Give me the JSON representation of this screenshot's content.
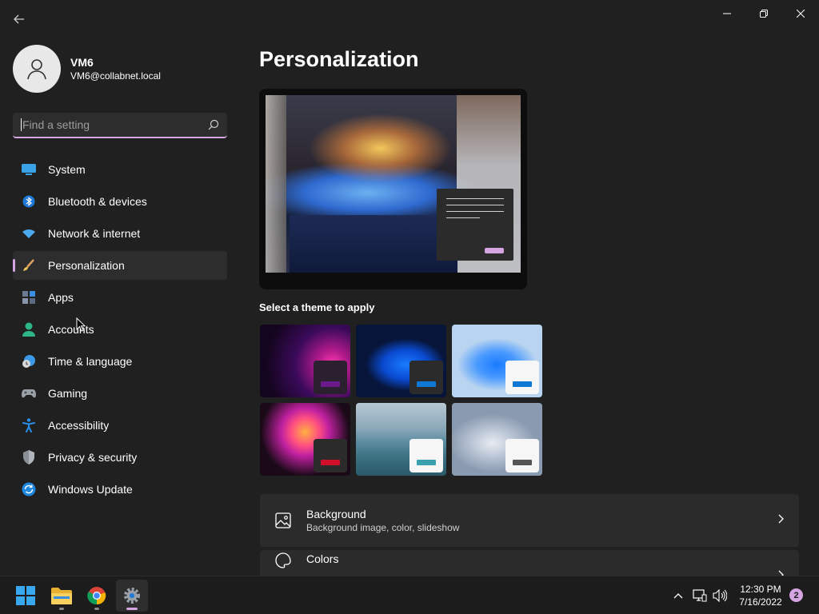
{
  "window": {
    "back_icon": "back-arrow-icon",
    "controls": [
      "minimize-icon",
      "restore-icon",
      "close-icon"
    ]
  },
  "profile": {
    "name": "VM6",
    "email": "VM6@collabnet.local"
  },
  "search": {
    "placeholder": "Find a setting",
    "icon": "search-icon"
  },
  "nav": {
    "items": [
      {
        "label": "System",
        "icon": "system-icon"
      },
      {
        "label": "Bluetooth & devices",
        "icon": "bluetooth-icon"
      },
      {
        "label": "Network & internet",
        "icon": "wifi-icon"
      },
      {
        "label": "Personalization",
        "icon": "brush-icon",
        "active": true
      },
      {
        "label": "Apps",
        "icon": "apps-icon"
      },
      {
        "label": "Accounts",
        "icon": "accounts-icon"
      },
      {
        "label": "Time & language",
        "icon": "clock-globe-icon"
      },
      {
        "label": "Gaming",
        "icon": "gamepad-icon"
      },
      {
        "label": "Accessibility",
        "icon": "accessibility-icon"
      },
      {
        "label": "Privacy & security",
        "icon": "shield-icon"
      },
      {
        "label": "Windows Update",
        "icon": "update-icon"
      }
    ]
  },
  "main": {
    "title": "Personalization",
    "themes_label": "Select a theme to apply",
    "themes": [
      {
        "name": "glow",
        "accent": "#6a1a8a"
      },
      {
        "name": "windows-dark",
        "accent": "#0f78d4"
      },
      {
        "name": "windows-light",
        "accent": "#0f78d4"
      },
      {
        "name": "captured-motion",
        "accent": "#d0102a"
      },
      {
        "name": "flow",
        "accent": "#3aa0b0"
      },
      {
        "name": "sunrise",
        "accent": "#555555"
      }
    ],
    "cards": [
      {
        "title": "Background",
        "subtitle": "Background image, color, slideshow",
        "icon": "image-icon"
      },
      {
        "title": "Colors",
        "subtitle": "",
        "icon": "palette-icon"
      }
    ]
  },
  "taskbar": {
    "apps": [
      "windows-start-icon",
      "file-explorer-icon",
      "chrome-icon",
      "settings-icon"
    ],
    "active_app": "settings-icon",
    "tray": [
      "chevron-up-icon",
      "network-icon",
      "volume-icon"
    ],
    "time": "12:30 PM",
    "date": "7/16/2022",
    "notifications": "2"
  },
  "colors": {
    "accent": "#d4a5e0",
    "background": "#202020",
    "card": "#2b2b2b"
  }
}
